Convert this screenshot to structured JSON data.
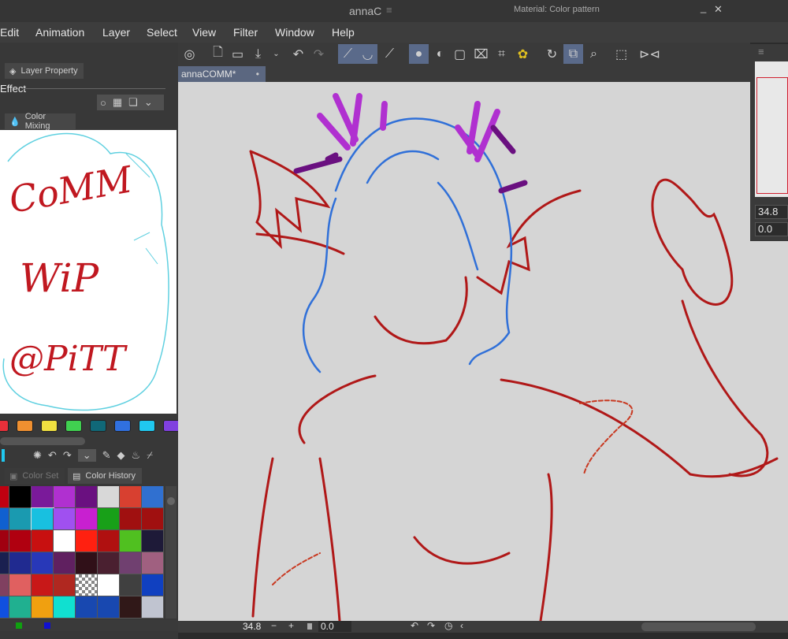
{
  "window": {
    "title": "annaC",
    "material_title": "Material: Color pattern",
    "minimize": "_",
    "close": "✕"
  },
  "menu": [
    "Edit",
    "Animation",
    "Layer",
    "Select",
    "View",
    "Filter",
    "Window",
    "Help"
  ],
  "toolbar_icons": [
    "cloud-icon",
    "new-file-icon",
    "open-folder-icon",
    "save-icon",
    "dropdown-icon",
    "undo-icon",
    "redo-icon",
    "pen-correction-icon",
    "stabilization-icon",
    "line-icon",
    "brush-size-icon",
    "brush-density-icon",
    "fit-icon",
    "fill-icon",
    "transform-icon",
    "color-icon",
    "rotate-icon",
    "snap-icon",
    "zoom-icon",
    "selection-icon",
    "flip-icon"
  ],
  "left_panel": {
    "layer_property_tab": "Layer Property",
    "effect_label": "Effect",
    "color_mixing_tab": "Color Mixing",
    "mixing_text": [
      "CoMM",
      "WiP",
      "@PiTT"
    ],
    "swatches": [
      "#e8303a",
      "#f09030",
      "#f0e040",
      "#40d050",
      "#106878",
      "#3070e0",
      "#20c8f0",
      "#8040e0"
    ],
    "color_set_tab": "Color Set",
    "color_history_tab": "Color History",
    "history": [
      [
        "#c00010",
        "#000000",
        "#7a1a9a",
        "#b030d0",
        "#6a1080",
        "#d8d8d8",
        "#d84030",
        "#3070d0"
      ],
      [
        "#1060d0",
        "#1a9ab0",
        "#18c0e0",
        "#a050f0",
        "#c820d0",
        "#18a018",
        "#a01010",
        "#a01010"
      ],
      [
        "#a00010",
        "#b00010",
        "#c81010",
        "#ffffff",
        "#ff2010",
        "#b01010",
        "#50c020",
        "#1e1a38"
      ],
      [
        "#1a2050",
        "#202a90",
        "#2838b8",
        "#602060",
        "#301018",
        "#4a2030",
        "#704070",
        "#a06080"
      ],
      [
        "#804060",
        "#e06060",
        "#c81818",
        "#b02820",
        "transparent",
        "#ffffff",
        "#404040",
        "#1040c0"
      ],
      [
        "#1050e0",
        "#20b090",
        "#f0a010",
        "#10e0d0",
        "#1848b0",
        "#1848b0",
        "#301818",
        "#c0c4d0"
      ]
    ]
  },
  "document": {
    "tab_label": "annaCOMM*"
  },
  "status": {
    "zoom": "34.8",
    "rotation": "0.0",
    "minus": "−",
    "plus": "+"
  },
  "navigator": {
    "zoom": "34.8",
    "rotation": "0.0"
  }
}
